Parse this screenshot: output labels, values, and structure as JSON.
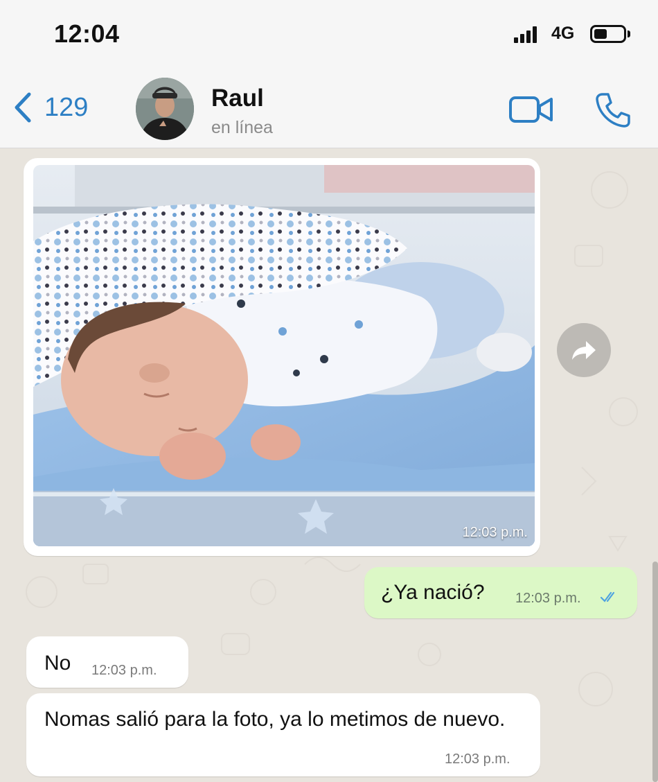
{
  "status_bar": {
    "time": "12:04",
    "network": "4G",
    "icons": [
      "signal-icon",
      "battery-icon"
    ]
  },
  "header": {
    "back_count": "129",
    "contact_name": "Raul",
    "contact_status": "en línea",
    "icons": [
      "chevron-left-icon",
      "video-call-icon",
      "phone-call-icon"
    ]
  },
  "messages": [
    {
      "direction": "incoming",
      "type": "image",
      "time": "12:03 p.m."
    },
    {
      "direction": "outgoing",
      "type": "text",
      "text": "¿Ya nació?",
      "time": "12:03 p.m.",
      "status": "read"
    },
    {
      "direction": "incoming",
      "type": "text",
      "text": "No",
      "time": "12:03 p.m."
    },
    {
      "direction": "incoming",
      "type": "text",
      "text": "Nomas salió para la foto, ya lo metimos de nuevo.",
      "time": "12:03 p.m."
    }
  ],
  "colors": {
    "accent": "#2d7fc4",
    "outgoing_bubble": "#dcf8c6",
    "incoming_bubble": "#ffffff",
    "wallpaper": "#e8e4dd",
    "read_ticks": "#4fa3e0"
  }
}
